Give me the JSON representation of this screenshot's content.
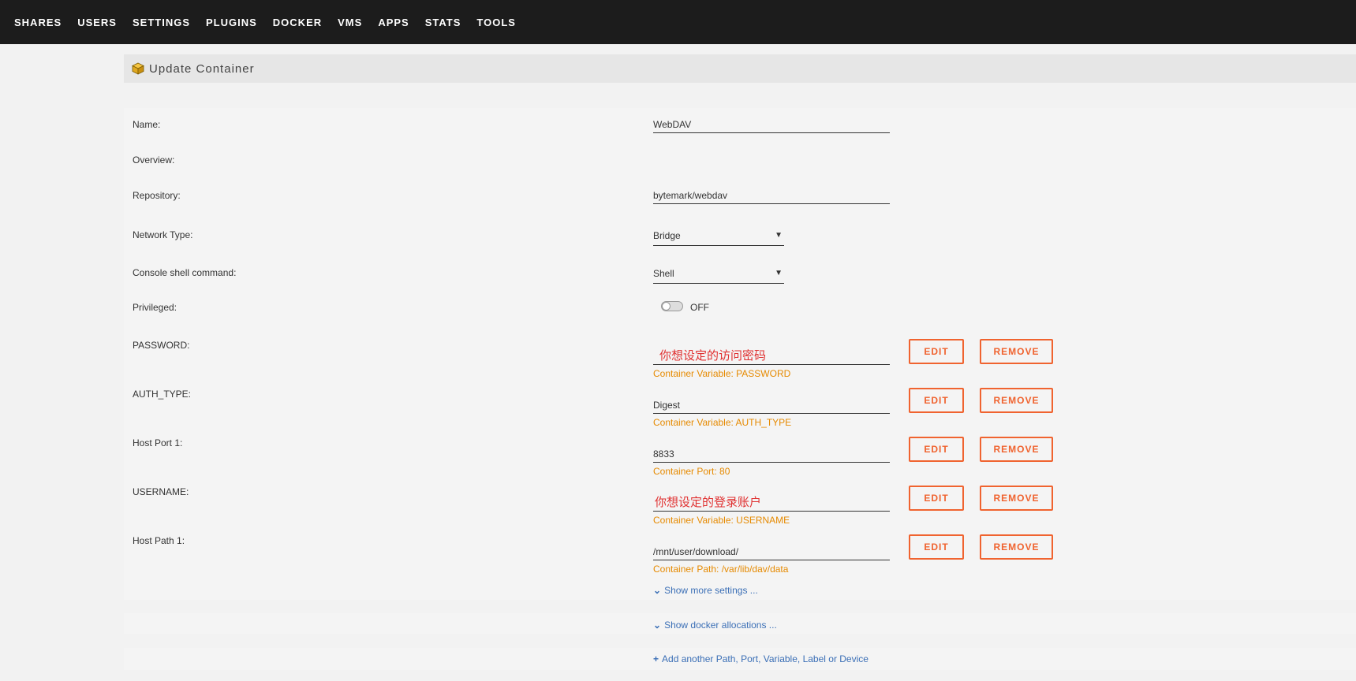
{
  "nav": [
    "SHARES",
    "USERS",
    "SETTINGS",
    "PLUGINS",
    "DOCKER",
    "VMS",
    "APPS",
    "STATS",
    "TOOLS"
  ],
  "header": {
    "title": "Update Container"
  },
  "form": {
    "name_label": "Name:",
    "name_value": "WebDAV",
    "overview_label": "Overview:",
    "repository_label": "Repository:",
    "repository_value": "bytemark/webdav",
    "network_label": "Network Type:",
    "network_value": "Bridge",
    "console_label": "Console shell command:",
    "console_value": "Shell",
    "privileged_label": "Privileged:",
    "privileged_state": "OFF"
  },
  "entries": [
    {
      "label": "PASSWORD:",
      "value": "你想设定的访问密码",
      "hint": "Container Variable: PASSWORD"
    },
    {
      "label": "AUTH_TYPE:",
      "value": "Digest",
      "hint": "Container Variable: AUTH_TYPE"
    },
    {
      "label": "Host Port 1:",
      "value": "8833",
      "hint": "Container Port: 80"
    },
    {
      "label": "USERNAME:",
      "value": "你想设定的登录账户",
      "hint": "Container Variable: USERNAME"
    },
    {
      "label": "Host Path 1:",
      "value": "/mnt/user/download/",
      "hint": "Container Path: /var/lib/dav/data"
    }
  ],
  "buttons": {
    "edit": "EDIT",
    "remove": "REMOVE"
  },
  "links": {
    "more_settings": "Show more settings ...",
    "docker_alloc": "Show docker allocations ...",
    "add_another": "Add another Path, Port, Variable, Label or Device"
  },
  "colors": {
    "accent": "#f0632f",
    "hint": "#e68a00",
    "link": "#3b6fb6",
    "annotation": "#e03131"
  }
}
